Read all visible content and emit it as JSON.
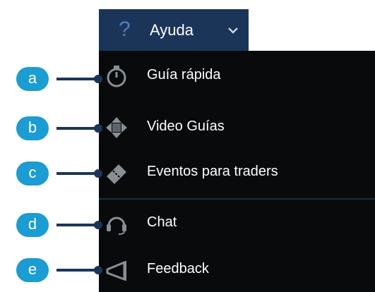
{
  "header": {
    "icon": "question-icon",
    "icon_glyph": "?",
    "label": "Ayuda",
    "chevron": "chevron-down-icon"
  },
  "menu": {
    "items": [
      {
        "label": "Guía rápida",
        "icon": "stopwatch-icon"
      },
      {
        "label": "Video Guías",
        "icon": "move-arrows-icon"
      },
      {
        "label": "Eventos para traders",
        "icon": "ticket-icon"
      },
      {
        "label": "Chat",
        "icon": "headset-icon"
      },
      {
        "label": "Feedback",
        "icon": "megaphone-icon"
      }
    ]
  },
  "callouts": [
    "a",
    "b",
    "c",
    "d",
    "e"
  ],
  "colors": {
    "header_bg": "#1b3558",
    "menu_bg": "#080a0c",
    "accent": "#1b9cd2",
    "icon_gray": "#8a8f96"
  }
}
